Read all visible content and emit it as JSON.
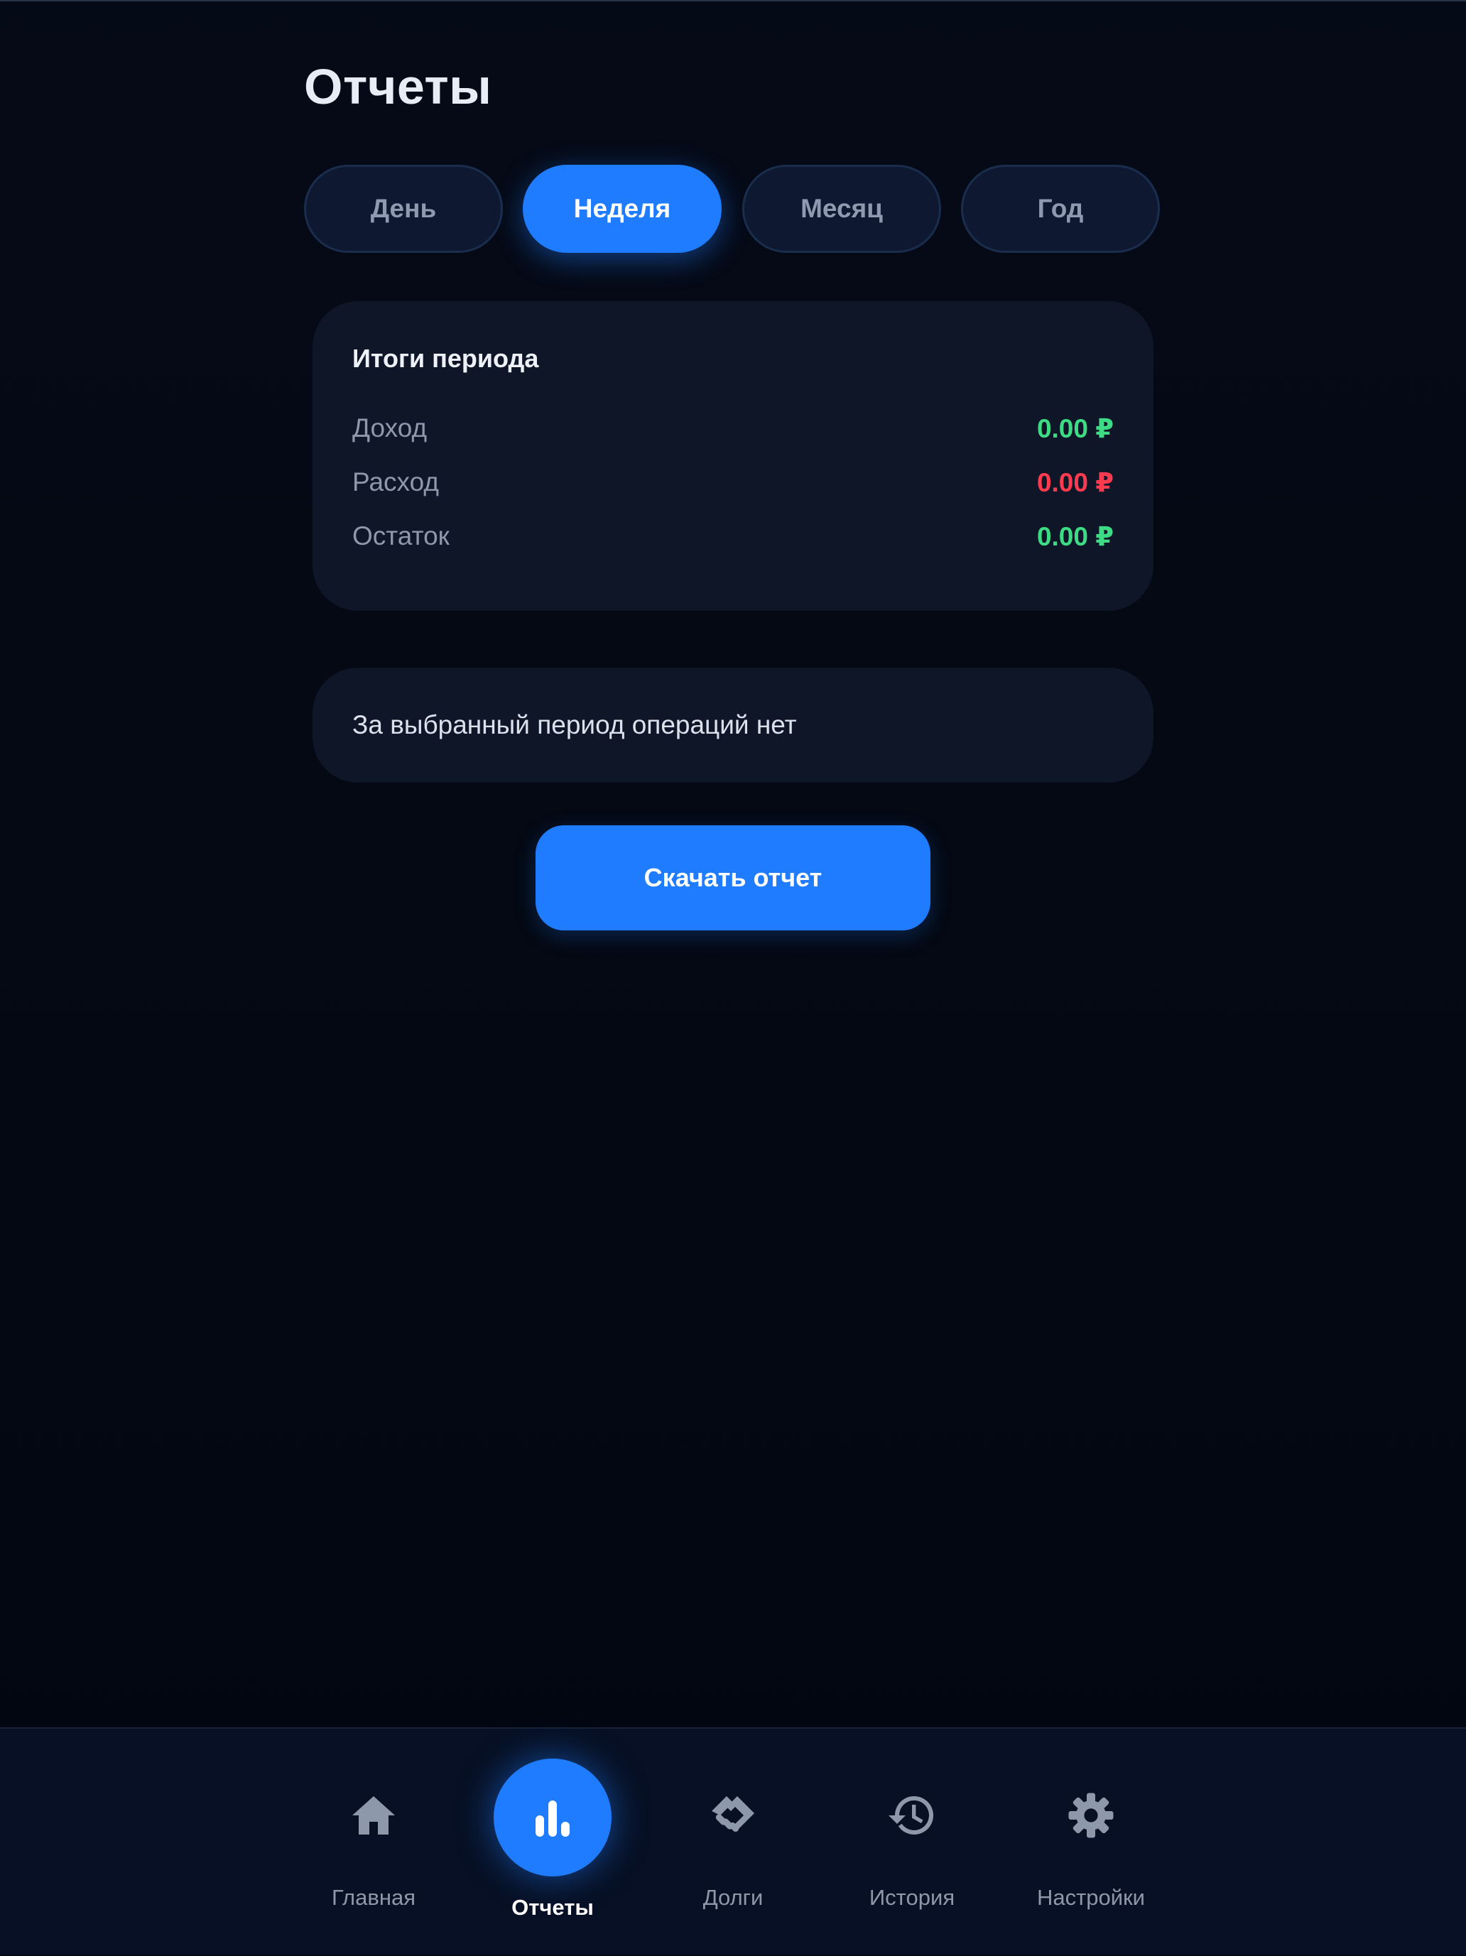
{
  "page": {
    "title": "Отчеты"
  },
  "tabs": [
    {
      "label": "День",
      "active": false
    },
    {
      "label": "Неделя",
      "active": true
    },
    {
      "label": "Месяц",
      "active": false
    },
    {
      "label": "Год",
      "active": false
    }
  ],
  "summary": {
    "title": "Итоги периода",
    "rows": [
      {
        "label": "Доход",
        "value": "0.00 ₽",
        "color": "#3ddc84"
      },
      {
        "label": "Расход",
        "value": "0.00 ₽",
        "color": "#ff3b4f"
      },
      {
        "label": "Остаток",
        "value": "0.00 ₽",
        "color": "#3ddc84"
      }
    ]
  },
  "empty_state": {
    "text": "За выбранный период операций нет"
  },
  "download_button": {
    "label": "Скачать отчет"
  },
  "bottom_nav": [
    {
      "label": "Главная",
      "icon": "home-icon",
      "active": false
    },
    {
      "label": "Отчеты",
      "icon": "bar-chart-icon",
      "active": true
    },
    {
      "label": "Долги",
      "icon": "handshake-icon",
      "active": false
    },
    {
      "label": "История",
      "icon": "history-icon",
      "active": false
    },
    {
      "label": "Настройки",
      "icon": "gear-icon",
      "active": false
    }
  ],
  "colors": {
    "accent": "#1f7cff",
    "income": "#3ddc84",
    "expense": "#ff3b4f",
    "background": "#040913",
    "card": "#0e1628"
  }
}
